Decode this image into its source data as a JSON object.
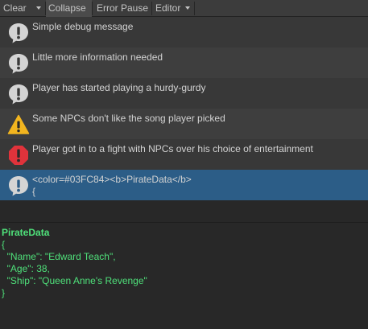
{
  "toolbar": {
    "clear": "Clear",
    "collapse": "Collapse",
    "error_pause": "Error Pause",
    "editor": "Editor"
  },
  "log": [
    {
      "type": "info",
      "icon": "info-icon",
      "message": "Simple debug message"
    },
    {
      "type": "info",
      "icon": "info-icon",
      "message": "Little more information needed"
    },
    {
      "type": "info",
      "icon": "info-icon",
      "message": "Player has started playing a hurdy-gurdy"
    },
    {
      "type": "warning",
      "icon": "warning-icon",
      "message": "Some NPCs don't like the song player picked"
    },
    {
      "type": "error",
      "icon": "error-icon",
      "message": "Player got in to a fight with NPCs over his choice of entertainment"
    },
    {
      "type": "info",
      "icon": "info-icon",
      "message": "<color=#03FC84><b>PirateData</b>",
      "message_line2": "{",
      "selected": true
    }
  ],
  "detail": {
    "title": "PirateData",
    "lines": [
      "{",
      "  \"Name\": \"Edward Teach\",",
      "  \"Age\": 38,",
      "  \"Ship\": \"Queen Anne's Revenge\"",
      "}"
    ]
  },
  "colors": {
    "toolbar": "#3c3c3c",
    "row_dark": "#383838",
    "row_light": "#3e3e3e",
    "selected": "#2c5d87",
    "detail_text": "#4fe07a",
    "warning": "#f2b51f",
    "error": "#e0333b",
    "info": "#d4d4d4"
  }
}
